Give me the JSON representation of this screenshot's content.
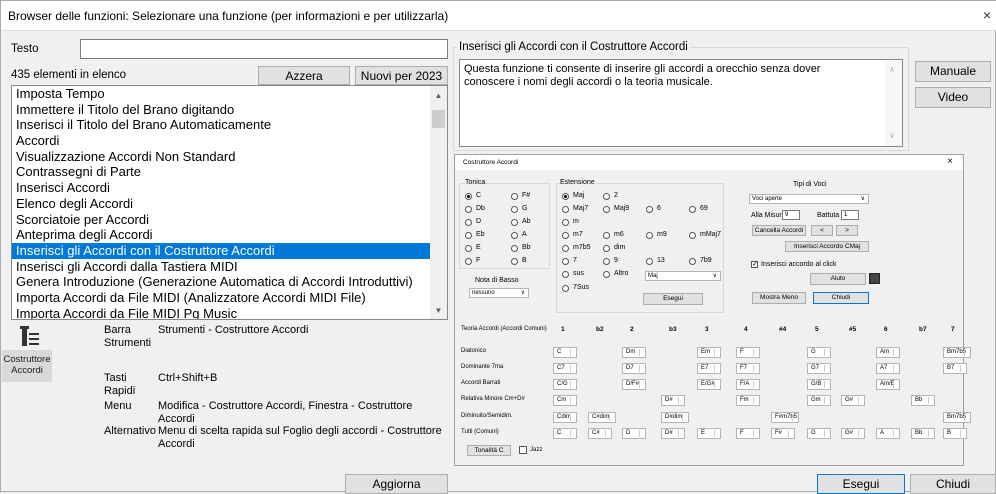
{
  "window": {
    "title": "Browser delle funzioni: Selezionare una funzione (per informazioni e per utilizzarla)",
    "close": "×"
  },
  "search": {
    "label": "Testo",
    "value": ""
  },
  "count": "435 elementi in elenco",
  "buttons": {
    "reset": "Azzera",
    "new2023": "Nuovi per 2023",
    "manual": "Manuale",
    "video": "Video",
    "refresh": "Aggiorna",
    "run": "Esegui",
    "close": "Chiudi"
  },
  "list": {
    "items": [
      "Imposta Tempo",
      "Immettere il Titolo del Brano digitando",
      "Inserisci il Titolo del Brano Automaticamente",
      "Accordi",
      "Visualizzazione Accordi Non Standard",
      "Contrassegni di Parte",
      "Inserisci Accordi",
      "Elenco degli Accordi",
      "Scorciatoie per Accordi",
      "Anteprima degli Accordi",
      "Inserisci gli Accordi con il Costruttore Accordi",
      "Inserisci gli Accordi dalla Tastiera MIDI",
      "Genera Introduzione (Generazione Automatica di Accordi Introduttivi)",
      "Importa Accordi da File MIDI (Analizzatore Accordi MIDI File)",
      "Importa Accordi da File MIDI Pg Music"
    ],
    "selected_index": 10
  },
  "details": {
    "icon_caption": "Costruttore Accordi",
    "rows": [
      {
        "key": "Barra Strumenti",
        "value": "Strumenti - Costruttore Accordi"
      },
      {
        "key": "Tasti Rapidi",
        "value": "Ctrl+Shift+B"
      },
      {
        "key": "Menu",
        "value": "Modifica - Costruttore Accordi, Finestra - Costruttore Accordi"
      },
      {
        "key": "Alternativo",
        "value": "Menu di scelta rapida sul Foglio degli accordi - Costruttore Accordi"
      }
    ]
  },
  "info": {
    "group_title": "Inserisci gli Accordi con il Costruttore Accordi",
    "description": "Questa funzione ti consente di inserire gli accordi a orecchio senza dover conoscere i nomi degli accordi o la teoria musicale."
  },
  "preview": {
    "title": "Costruttore Accordi",
    "close": "×",
    "tonic": {
      "label": "Tonica",
      "options": [
        "C",
        "F#",
        "Db",
        "G",
        "D",
        "Ab",
        "Eb",
        "A",
        "E",
        "Bb",
        "F",
        "B"
      ],
      "selected": "C"
    },
    "bass": {
      "label": "Nota di Basso",
      "value": "nessuno"
    },
    "extension": {
      "label": "Estensione",
      "options": [
        "Maj",
        "2",
        "Maj7",
        "Maj9",
        "6",
        "69",
        "m",
        "m7",
        "m6",
        "m9",
        "mMaj7",
        "m7b5",
        "dim",
        "7",
        "9",
        "13",
        "7b9",
        "sus",
        "Altro",
        "7Sus"
      ],
      "selected": "Maj",
      "combo": "Maj"
    },
    "voicing": {
      "label": "Tipi di Voci",
      "value": "Voci aperte"
    },
    "bar": {
      "measure_label": "Alla Misura",
      "measure": "9",
      "beat_label": "Battuta",
      "beat": "1"
    },
    "buttons": {
      "clear": "Cancella Accordi",
      "prev": "<",
      "next": ">",
      "insert": "Inserisci Accordo CMaj",
      "help": "Aiuto",
      "less": "Mostra Meno",
      "close": "Chiudi",
      "run": "Esegui",
      "key": "Tonalità C"
    },
    "insert_on_click": "Inserisci accordo al click",
    "jazz": "Jazz",
    "theory": {
      "label": "Teoria Accordi (Accordi Comuni)",
      "degrees": [
        "1",
        "b2",
        "2",
        "b3",
        "3",
        "4",
        "#4",
        "5",
        "#5",
        "6",
        "b7",
        "7"
      ],
      "rows": [
        {
          "name": "Diatonico",
          "chords": [
            "C",
            "",
            "Dm",
            "",
            "Em",
            "F",
            "",
            "G",
            "",
            "Am",
            "",
            "Bm7b5"
          ]
        },
        {
          "name": "Dominante 7ma",
          "chords": [
            "C7",
            "",
            "D7",
            "",
            "E7",
            "F7",
            "",
            "G7",
            "",
            "A7",
            "",
            "B7"
          ]
        },
        {
          "name": "Accordi Barrati",
          "chords": [
            "C/G",
            "",
            "D/F#",
            "",
            "E/G#",
            "F/A",
            "",
            "G/B",
            "",
            "Am/E",
            "",
            ""
          ]
        },
        {
          "name": "Relativa Minore Cm+D#",
          "chords": [
            "Cm",
            "",
            "",
            "D#",
            "",
            "Fm",
            "",
            "Gm",
            "G#",
            "",
            "Bb",
            ""
          ]
        },
        {
          "name": "Diminuito/Semidim.",
          "chords": [
            "Cdim",
            "C#dim",
            "",
            "D#dim",
            "",
            "",
            "F#m7b5",
            "",
            "",
            "",
            "",
            "Bm7b5"
          ]
        },
        {
          "name": "Tutti (Comuni)",
          "chords": [
            "C",
            "C#",
            "D",
            "D#",
            "E",
            "F",
            "F#",
            "G",
            "G#",
            "A",
            "Bb",
            "B"
          ]
        }
      ]
    }
  }
}
